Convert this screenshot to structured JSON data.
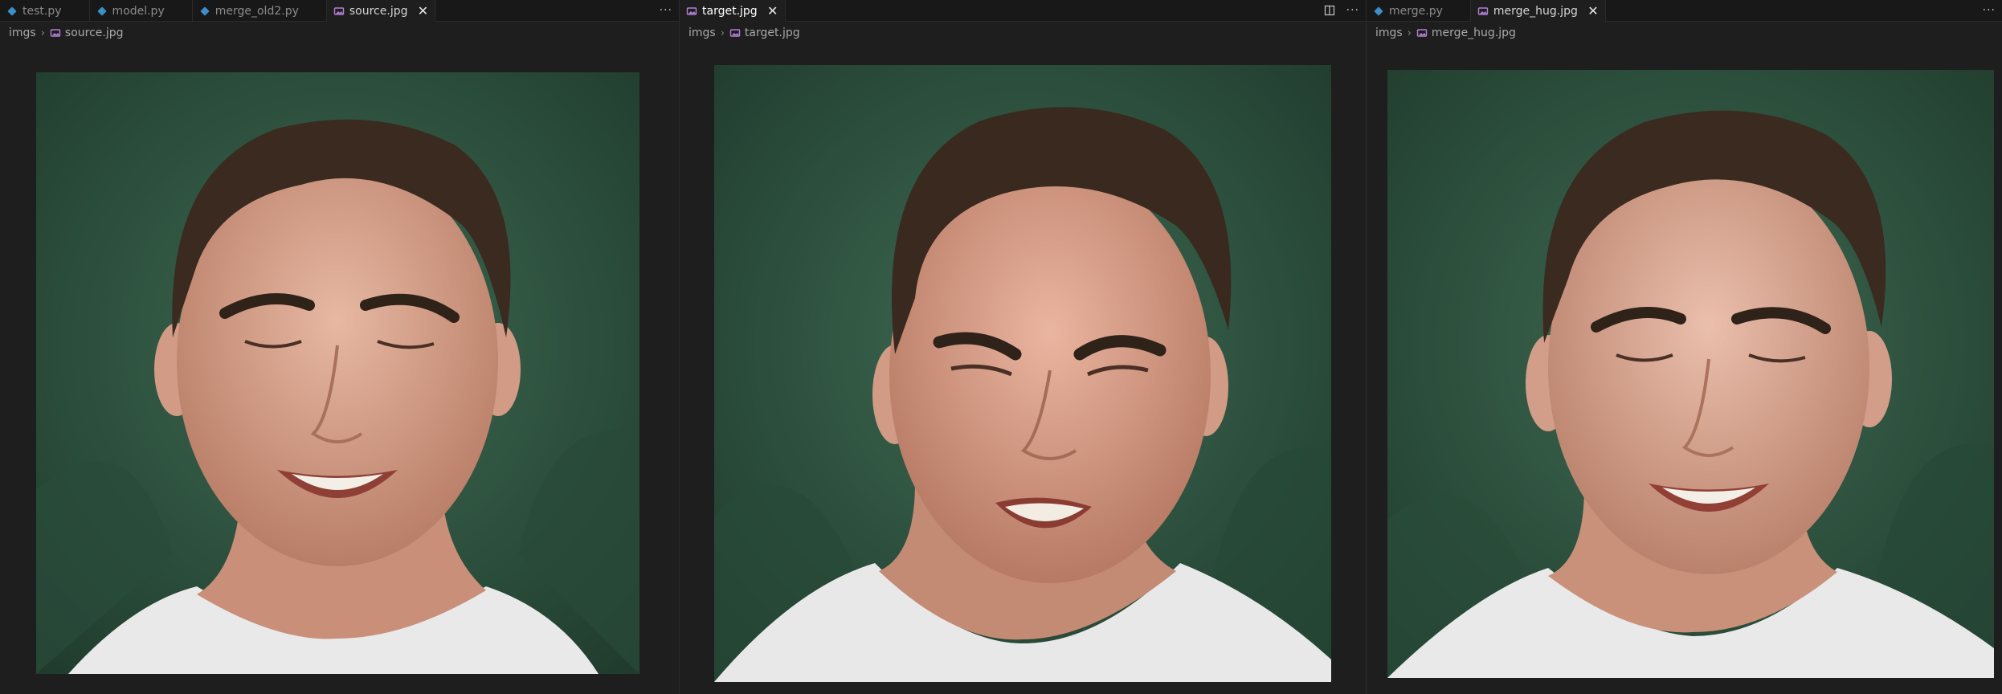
{
  "groups": [
    {
      "tabs": [
        {
          "label": "test.py",
          "type": "python"
        },
        {
          "label": "model.py",
          "type": "python"
        },
        {
          "label": "merge_old2.py",
          "type": "python"
        },
        {
          "label": "source.jpg",
          "type": "image",
          "active": true
        }
      ],
      "actions": [
        "more-actions"
      ],
      "breadcrumb": {
        "folder": "imgs",
        "file": "source.jpg"
      },
      "image": {
        "subject": "man with closed eyes smiling, green backdrop"
      }
    },
    {
      "tabs": [
        {
          "label": "target.jpg",
          "type": "image",
          "active": true
        }
      ],
      "actions": [
        "split-editor",
        "more-actions"
      ],
      "breadcrumb": {
        "folder": "imgs",
        "file": "target.jpg"
      },
      "image": {
        "subject": "man squinting and grimacing, green backdrop"
      }
    },
    {
      "tabs": [
        {
          "label": "merge.py",
          "type": "python"
        },
        {
          "label": "merge_hug.jpg",
          "type": "image",
          "active": true
        }
      ],
      "actions": [
        "more-actions"
      ],
      "breadcrumb": {
        "folder": "imgs",
        "file": "merge_hug.jpg"
      },
      "image": {
        "subject": "merged face, closed eyes smiling, green backdrop"
      }
    }
  ],
  "icons": {
    "python": "python-file-icon",
    "image": "image-file-icon",
    "chevron": "chevron-right-icon",
    "more": "ellipsis-icon",
    "split": "split-editor-icon"
  },
  "colors": {
    "background": "#1e1e1e",
    "tabbar": "#181818",
    "python_icon": "#3b8ec9",
    "image_icon": "#b180d7",
    "backdrop": "#2f5a44"
  }
}
